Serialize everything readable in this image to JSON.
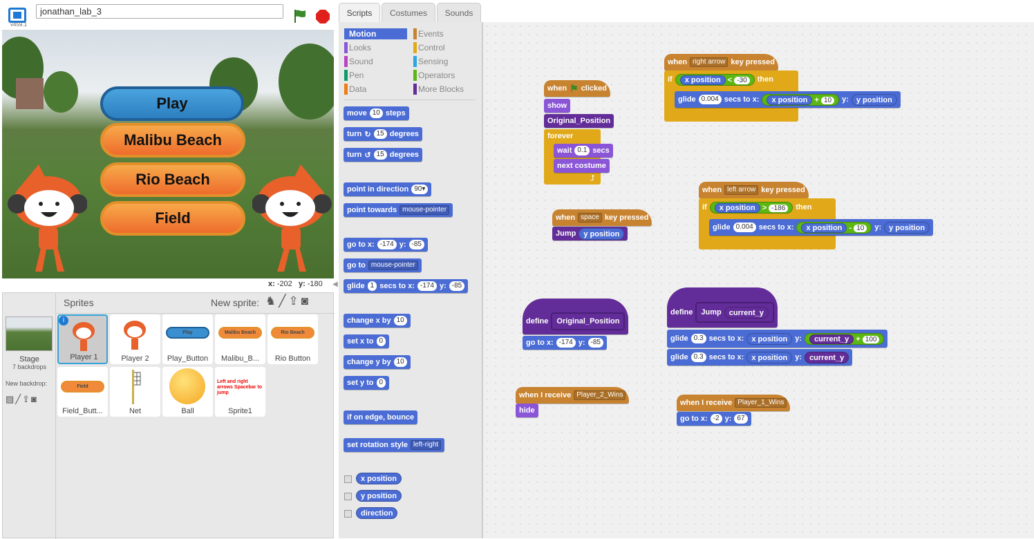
{
  "header": {
    "project_title": "jonathan_lab_3",
    "version": "v459.1",
    "fullscreen_icon": "fullscreen-icon",
    "flag_icon": "green-flag-icon",
    "stop_icon": "stop-sign-icon",
    "colors": {
      "flag": "#3a8a2a",
      "stop": "#e0201b"
    }
  },
  "stage": {
    "buttons": [
      "Play",
      "Malibu Beach",
      "Rio Beach",
      "Field"
    ],
    "coord_x_label": "x:",
    "coord_x": "-202",
    "coord_y_label": "y:",
    "coord_y": "-180"
  },
  "sprites_pane": {
    "title": "Sprites",
    "new_sprite_label": "New sprite:",
    "stage_label": "Stage",
    "stage_backdrops": "7 backdrops",
    "new_backdrop_label": "New backdrop:",
    "sprites": [
      {
        "name": "Player 1",
        "selected": true
      },
      {
        "name": "Player 2"
      },
      {
        "name": "Play_Button",
        "thumb_text": "Play"
      },
      {
        "name": "Malibu_B...",
        "thumb_text": "Malibu Beach"
      },
      {
        "name": "Rio Button",
        "thumb_text": "Rio Beach"
      },
      {
        "name": "Field_Butt...",
        "thumb_text": "Field"
      },
      {
        "name": "Net"
      },
      {
        "name": "Ball"
      },
      {
        "name": "Sprite1",
        "thumb_text": "Left and right arrows Spacebar to jump"
      }
    ]
  },
  "tabs": [
    "Scripts",
    "Costumes",
    "Sounds"
  ],
  "categories": {
    "left": [
      "Motion",
      "Looks",
      "Sound",
      "Pen",
      "Data"
    ],
    "right": [
      "Events",
      "Control",
      "Sensing",
      "Operators",
      "More Blocks"
    ],
    "colors": {
      "Motion": "#4a6cd4",
      "Looks": "#8a55d7",
      "Sound": "#bb42c3",
      "Pen": "#0e9a6c",
      "Data": "#ee7d16",
      "Events": "#c88330",
      "Control": "#e1a91a",
      "Sensing": "#2ca5e2",
      "Operators": "#5cb712",
      "More Blocks": "#632d99"
    }
  },
  "palette": {
    "move": {
      "a": "move",
      "n": "10",
      "b": "steps"
    },
    "turn_cw": {
      "a": "turn",
      "n": "15",
      "b": "degrees"
    },
    "turn_ccw": {
      "a": "turn",
      "n": "15",
      "b": "degrees"
    },
    "point_dir": {
      "a": "point in direction",
      "n": "90▾"
    },
    "point_towards": {
      "a": "point towards",
      "d": "mouse-pointer"
    },
    "goto_xy": {
      "a": "go to x:",
      "x": "-174",
      "b": "y:",
      "y": "-85"
    },
    "goto": {
      "a": "go to",
      "d": "mouse-pointer"
    },
    "glide": {
      "a": "glide",
      "n": "1",
      "b": "secs to x:",
      "x": "-174",
      "c": "y:",
      "y": "-85"
    },
    "change_x": {
      "a": "change x by",
      "n": "10"
    },
    "set_x": {
      "a": "set x to",
      "n": "0"
    },
    "change_y": {
      "a": "change y by",
      "n": "10"
    },
    "set_y": {
      "a": "set y to",
      "n": "0"
    },
    "bounce": {
      "a": "if on edge, bounce"
    },
    "rotation": {
      "a": "set rotation style",
      "d": "left-right"
    },
    "reporters": [
      "x position",
      "y position",
      "direction"
    ]
  },
  "scripts": {
    "s1": {
      "when": "when",
      "clicked": "clicked",
      "show": "show",
      "orig": "Original_Position",
      "forever": "forever",
      "wait": "wait",
      "wait_n": "0.1",
      "secs": "secs",
      "next": "next costume"
    },
    "s2": {
      "when": "when",
      "key": "right arrow",
      "pressed": "key pressed",
      "if": "if",
      "xpos": "x position",
      "lt": "<",
      "val": "-30",
      "then": "then",
      "glide": "glide",
      "g_n": "0.004",
      "secs_to": "secs to x:",
      "plus": "+",
      "add": "10",
      "y": "y:",
      "ypos": "y position"
    },
    "s3": {
      "when": "when",
      "key": "left arrow",
      "pressed": "key pressed",
      "if": "if",
      "xpos": "x position",
      "gt": ">",
      "val": "-186",
      "then": "then",
      "glide": "glide",
      "g_n": "0.004",
      "secs_to": "secs to x:",
      "minus": "-",
      "sub": "10",
      "y": "y:",
      "ypos": "y position"
    },
    "s4": {
      "when": "when",
      "key": "space",
      "pressed": "key pressed",
      "jump": "Jump",
      "ypos": "y position"
    },
    "s5": {
      "define": "define",
      "name": "Original_Position",
      "goto": "go to x:",
      "x": "-174",
      "y": "y:",
      "yv": "-85"
    },
    "s6": {
      "define": "define",
      "name": "Jump",
      "param": "current_y",
      "glide": "glide",
      "n1": "0.3",
      "secs_to": "secs to x:",
      "xpos": "x position",
      "y": "y:",
      "plus": "+",
      "add": "100",
      "n2": "0.3"
    },
    "s7": {
      "when": "when I receive",
      "msg": "Player_2_Wins",
      "hide": "hide"
    },
    "s8": {
      "when": "when I receive",
      "msg": "Player_1_Wins",
      "goto": "go to x:",
      "x": "-2",
      "y": "y:",
      "yv": "67"
    }
  }
}
